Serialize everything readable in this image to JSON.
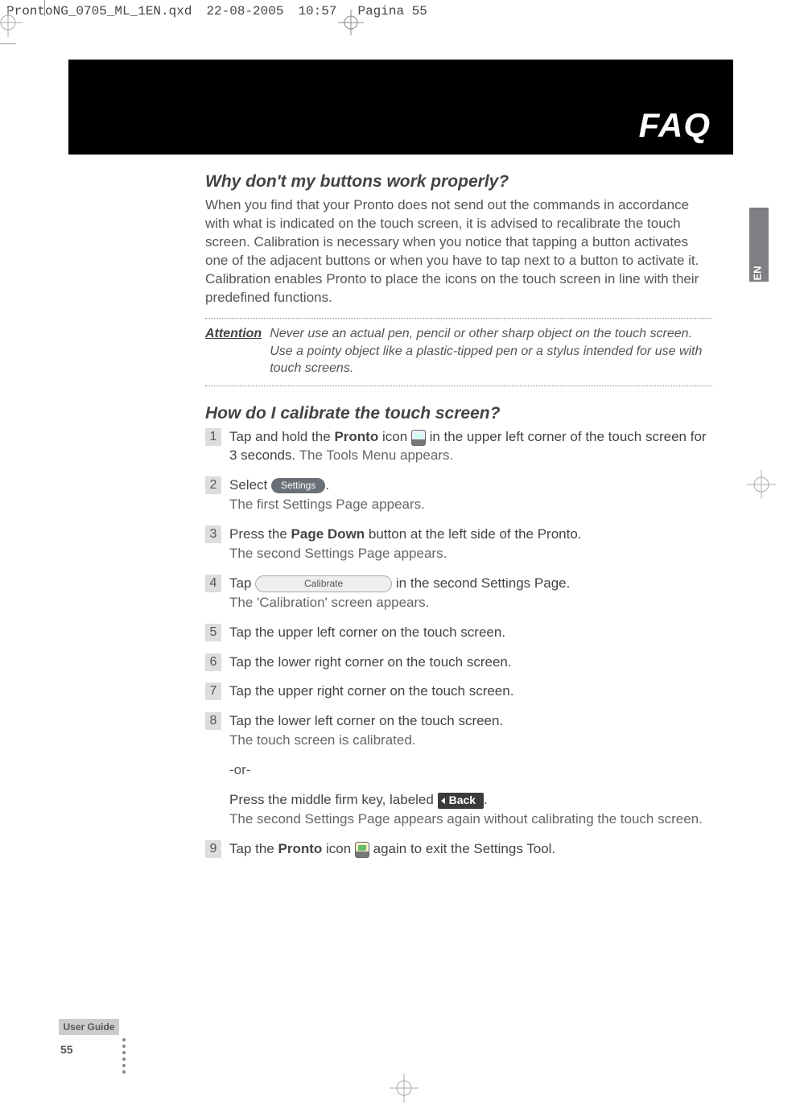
{
  "header": {
    "file": "ProntoNG_0705_ML_1EN.qxd",
    "date": "22-08-2005",
    "time": "10:57",
    "page": "Pagina 55"
  },
  "faq_title": "FAQ",
  "side_tab": "EN",
  "section1": {
    "heading": "Why don't my buttons work properly?",
    "body": "When you find that your Pronto does not send out the commands in accordance with what is indicated on the touch screen, it is advised to recalibrate the touch screen. Calibration is necessary when you notice that tapping a button activates one of the adjacent buttons or when you have to tap next to a button to activate it. Calibration enables Pronto to place the icons on the touch screen in line with their predefined functions."
  },
  "attention": {
    "label": "Attention",
    "body": "Never use an actual pen, pencil or other sharp object on the touch screen. Use a pointy object like a plastic-tipped pen or a stylus intended for use with touch screens."
  },
  "section2": {
    "heading": "How do I calibrate the touch screen?"
  },
  "steps": {
    "s1a": "Tap and hold the ",
    "s1_bold": "Pronto",
    "s1b": " icon ",
    "s1c": " in the upper left corner of the touch screen for 3 seconds.",
    "s1_sub": " The Tools Menu appears.",
    "s2a": "Select ",
    "pill_settings": "Settings",
    "s2_sub": "The first Settings Page appears.",
    "s3a": "Press the ",
    "s3_bold": "Page Down",
    "s3b": " button at the left side of the Pronto.",
    "s3_sub": "The second Settings Page appears.",
    "s4a": "Tap ",
    "pill_calibrate": "Calibrate",
    "s4b": " in the second Settings Page.",
    "s4_sub": "The 'Calibration' screen appears.",
    "s5": "Tap the upper left corner on the touch screen.",
    "s6": "Tap the lower right corner on the touch screen.",
    "s7": "Tap the upper right corner on the touch screen.",
    "s8": "Tap the lower left corner on the touch screen.",
    "s8_sub": "The touch screen is calibrated.",
    "or": "-or-",
    "press_a": "Press the middle firm key, labeled ",
    "back_label": "Back",
    "press_sub": "The second Settings Page appears again without calibrating the touch screen.",
    "s9a": "Tap the ",
    "s9_bold": "Pronto",
    "s9b": " icon ",
    "s9c": " again to exit the Settings Tool."
  },
  "footer": {
    "guide": "User Guide",
    "page": "55"
  }
}
